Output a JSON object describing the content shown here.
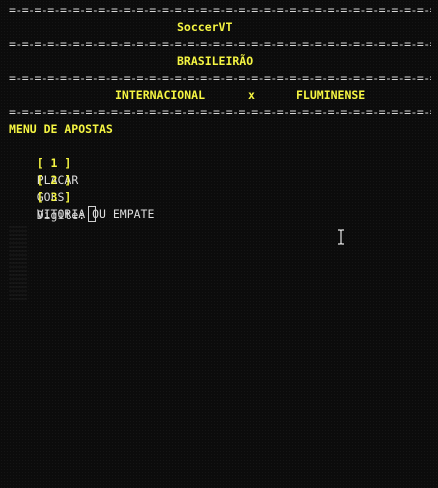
{
  "header": {
    "separator": "=-=-=-=-=-=-=-=-=-=-=-=-=-=-=-=-=-=-=-=-=-=-=-=-=-=-=-=-=-=-=-=-=-=-=-=-=",
    "app_title": "SoccerVT",
    "league": "BRASILEIRÃO"
  },
  "match": {
    "home_team": "INTERNACIONAL",
    "versus": "x",
    "away_team": "FLUMINENSE"
  },
  "menu": {
    "title": "MENU DE APOSTAS",
    "options": [
      {
        "key": "[ 1 ]",
        "label": "PLACAR"
      },
      {
        "key": "[ 2 ]",
        "label": "GOLS"
      },
      {
        "key": "[ 3 ]",
        "label": "VITORIA OU EMPATE"
      }
    ],
    "prompt": "Digite:"
  },
  "colors": {
    "background": "#0c0c0c",
    "highlight": "#f5f542",
    "text": "#d8d8d8"
  },
  "icons": {
    "mouse_cursor": "i-beam-cursor-icon",
    "text_caret": "block-caret-icon"
  }
}
